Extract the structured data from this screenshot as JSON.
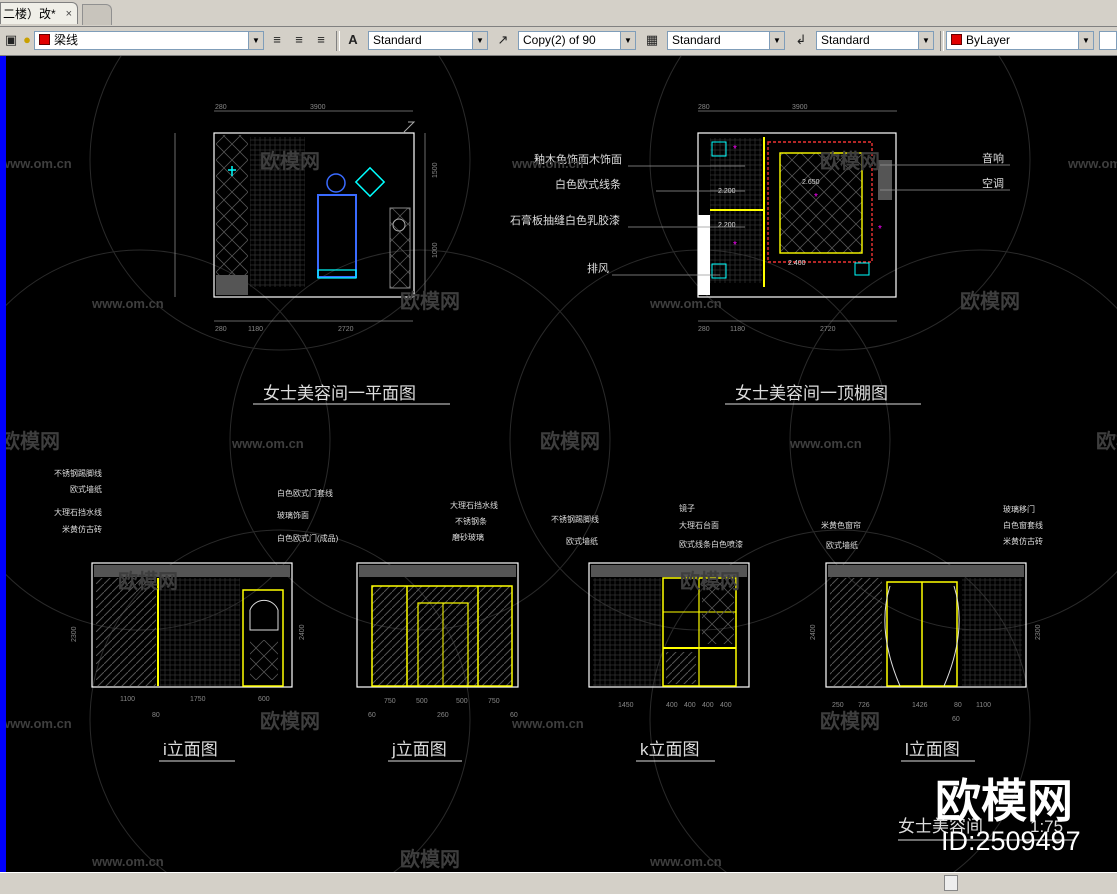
{
  "document_tab": {
    "title": "二楼）改*",
    "close": "×"
  },
  "toolbar": {
    "layer": "梁线",
    "text_style": "Standard",
    "dim_style": "Copy(2) of 90",
    "table_style": "Standard",
    "multileader_style": "Standard",
    "color": "ByLayer"
  },
  "drawings": {
    "plan_title": "女士美容间一平面图",
    "ceiling_title": "女士美容间一顶棚图",
    "bottom_title": "女士美容间",
    "bottom_scale": "1:75",
    "plan_dims_top": [
      "280",
      "3900"
    ],
    "plan_dims_bottom": [
      "280",
      "1180",
      "2720"
    ],
    "plan_dims_right": [
      "1500",
      "1000"
    ],
    "ceiling_dims_top": [
      "280",
      "3900"
    ],
    "ceiling_dims_bottom": [
      "280",
      "1180",
      "2720"
    ],
    "ceiling_levels": [
      "2.200",
      "2.200",
      "2.650",
      "2.400"
    ],
    "ceiling_labels_left": [
      "釉木色饰面木饰面",
      "白色欧式线条",
      "石膏板抽缝白色乳胶漆",
      "排风"
    ],
    "ceiling_labels_right": [
      "音响",
      "空调"
    ]
  },
  "elevations": [
    {
      "title": "i立面图",
      "notes": [
        "不锈钢踢脚线",
        "欧式墙纸",
        "大理石挡水线",
        "米黄仿古砖",
        "白色欧式门套线",
        "玻璃饰面",
        "白色欧式门(成品)"
      ],
      "dims": [
        "1100",
        "1750",
        "600",
        "80",
        "2400",
        "2300"
      ]
    },
    {
      "title": "j立面图",
      "notes": [
        "大理石挡水线",
        "不锈钢条",
        "磨砂玻璃"
      ],
      "dims": [
        "750",
        "500",
        "500",
        "750",
        "260",
        "60",
        "60"
      ]
    },
    {
      "title": "k立面图",
      "notes": [
        "不锈钢踢脚线",
        "欧式墙纸",
        "镜子",
        "大理石台面",
        "欧式线条白色喷漆"
      ],
      "dims": [
        "1450",
        "400",
        "400",
        "400",
        "400"
      ]
    },
    {
      "title": "l立面图",
      "notes": [
        "米黄色窗帘",
        "欧式墙纸",
        "玻璃移门",
        "白色窗套线",
        "米黄仿古砖"
      ],
      "dims": [
        "250",
        "726",
        "1426",
        "80",
        "1100",
        "60",
        "2400",
        "2300"
      ]
    }
  ],
  "watermark": {
    "brand": "欧模网",
    "site": "www.om.cn",
    "id": "ID:2509497"
  }
}
